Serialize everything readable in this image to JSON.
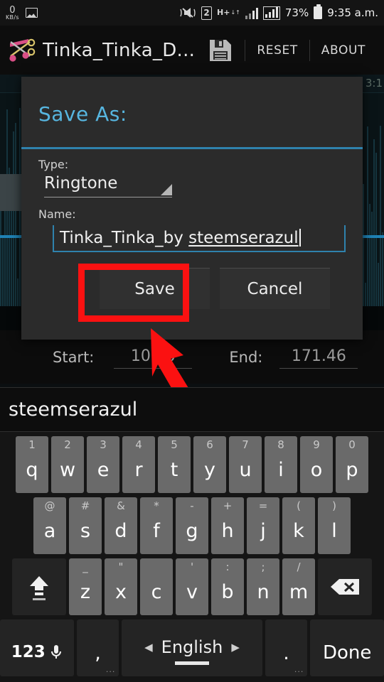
{
  "statusbar": {
    "net_speed_value": "0",
    "net_speed_unit": "KB/s",
    "gallery_icon": "image-icon",
    "vibrate_icon": "vibrate-mute-icon",
    "sim_badge": "2",
    "network_type": "H+",
    "network_arrows": "↓↑",
    "signal_icon": "signal-bars-icon",
    "signal_boxed_icon": "signal-bars-boxed-icon",
    "battery_percent": "73%",
    "battery_icon": "battery-full-icon",
    "time": "9:35 a.m."
  },
  "appbar": {
    "logo_icon": "music-scissors-icon",
    "title": "Tinka_Tinka_D...",
    "save_icon": "floppy-disk-icon",
    "reset_label": "RESET",
    "about_label": "ABOUT"
  },
  "waveform": {
    "timestamp": "3:1",
    "handle_icon": "left-marker-handle"
  },
  "startend": {
    "start_label": "Start:",
    "start_value": "106.0",
    "end_label": "End:",
    "end_value": "171.46"
  },
  "dialog": {
    "title": "Save As:",
    "type_label": "Type:",
    "type_value": "Ringtone",
    "type_dropdown_icon": "spinner-triangle-icon",
    "name_label": "Name:",
    "name_value_plain": "Tinka_Tinka_by ",
    "name_value_composing": "steemserazul",
    "save_label": "Save",
    "cancel_label": "Cancel"
  },
  "annotation": {
    "highlight_color": "#fb1111",
    "arrow_color": "#fb1111",
    "highlight_target": "save-button",
    "arrow_icon": "pointer-arrow-annotation"
  },
  "keyboard": {
    "suggestion": "steemserazul",
    "row1": [
      {
        "main": "q",
        "alt": "1"
      },
      {
        "main": "w",
        "alt": "2"
      },
      {
        "main": "e",
        "alt": "3"
      },
      {
        "main": "r",
        "alt": "4"
      },
      {
        "main": "t",
        "alt": "5"
      },
      {
        "main": "y",
        "alt": "6"
      },
      {
        "main": "u",
        "alt": "7"
      },
      {
        "main": "i",
        "alt": "8"
      },
      {
        "main": "o",
        "alt": "9"
      },
      {
        "main": "p",
        "alt": "0"
      }
    ],
    "row2": [
      {
        "main": "a",
        "alt": "@"
      },
      {
        "main": "s",
        "alt": "#"
      },
      {
        "main": "d",
        "alt": "&"
      },
      {
        "main": "f",
        "alt": "*"
      },
      {
        "main": "g",
        "alt": "-"
      },
      {
        "main": "h",
        "alt": "+"
      },
      {
        "main": "j",
        "alt": "="
      },
      {
        "main": "k",
        "alt": "("
      },
      {
        "main": "l",
        "alt": ")"
      }
    ],
    "row3": [
      {
        "main": "z",
        "alt": "_"
      },
      {
        "main": "x",
        "alt": "\""
      },
      {
        "main": "c",
        "alt": ""
      },
      {
        "main": "v",
        "alt": "'"
      },
      {
        "main": "b",
        "alt": ":"
      },
      {
        "main": "n",
        "alt": ";"
      },
      {
        "main": "m",
        "alt": "/"
      }
    ],
    "shift_icon": "shift-key-icon",
    "backspace_icon": "backspace-key-icon",
    "numeric_label": "123",
    "mic_icon": "microphone-icon",
    "comma_key": ",",
    "period_key": ".",
    "space_label": "English",
    "space_prev_icon": "◀",
    "space_next_icon": "▶",
    "done_label": "Done"
  }
}
